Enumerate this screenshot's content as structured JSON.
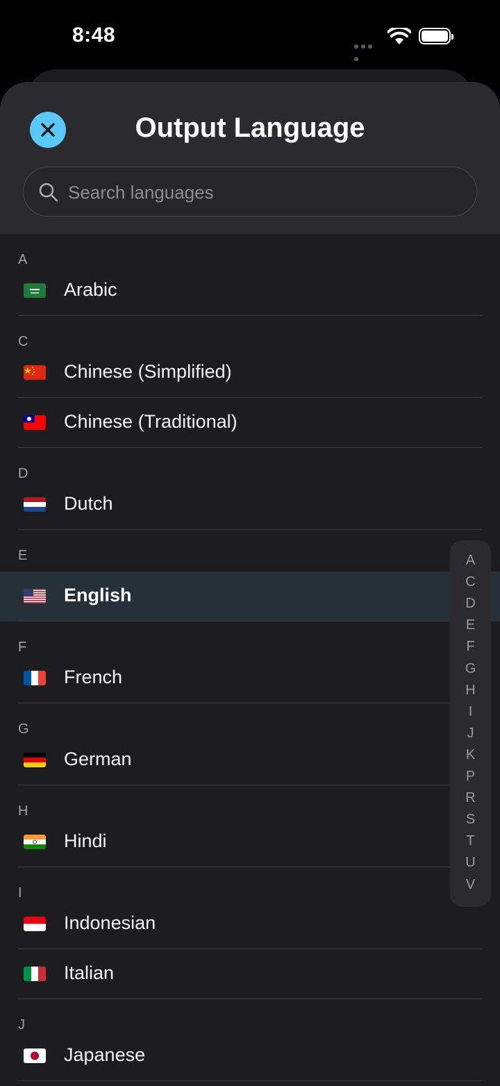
{
  "status": {
    "time": "8:48"
  },
  "header": {
    "title": "Output Language"
  },
  "search": {
    "placeholder": "Search languages"
  },
  "sections": [
    {
      "letter": "A",
      "items": [
        {
          "label": "Arabic",
          "flag": "sa"
        }
      ]
    },
    {
      "letter": "C",
      "items": [
        {
          "label": "Chinese (Simplified)",
          "flag": "cn"
        },
        {
          "label": "Chinese (Traditional)",
          "flag": "tw"
        }
      ]
    },
    {
      "letter": "D",
      "items": [
        {
          "label": "Dutch",
          "flag": "nl"
        }
      ]
    },
    {
      "letter": "E",
      "items": [
        {
          "label": "English",
          "flag": "us",
          "selected": true
        }
      ]
    },
    {
      "letter": "F",
      "items": [
        {
          "label": "French",
          "flag": "fr"
        }
      ]
    },
    {
      "letter": "G",
      "items": [
        {
          "label": "German",
          "flag": "de"
        }
      ]
    },
    {
      "letter": "H",
      "items": [
        {
          "label": "Hindi",
          "flag": "in"
        }
      ]
    },
    {
      "letter": "I",
      "items": [
        {
          "label": "Indonesian",
          "flag": "id"
        },
        {
          "label": "Italian",
          "flag": "it"
        }
      ]
    },
    {
      "letter": "J",
      "items": [
        {
          "label": "Japanese",
          "flag": "jp"
        }
      ]
    }
  ],
  "index": [
    "A",
    "C",
    "D",
    "E",
    "F",
    "G",
    "H",
    "I",
    "J",
    "K",
    "P",
    "R",
    "S",
    "T",
    "U",
    "V"
  ],
  "colors": {
    "accent": "#5ac8fa",
    "selected_row": "#263039",
    "background": "#1d1d1f"
  }
}
